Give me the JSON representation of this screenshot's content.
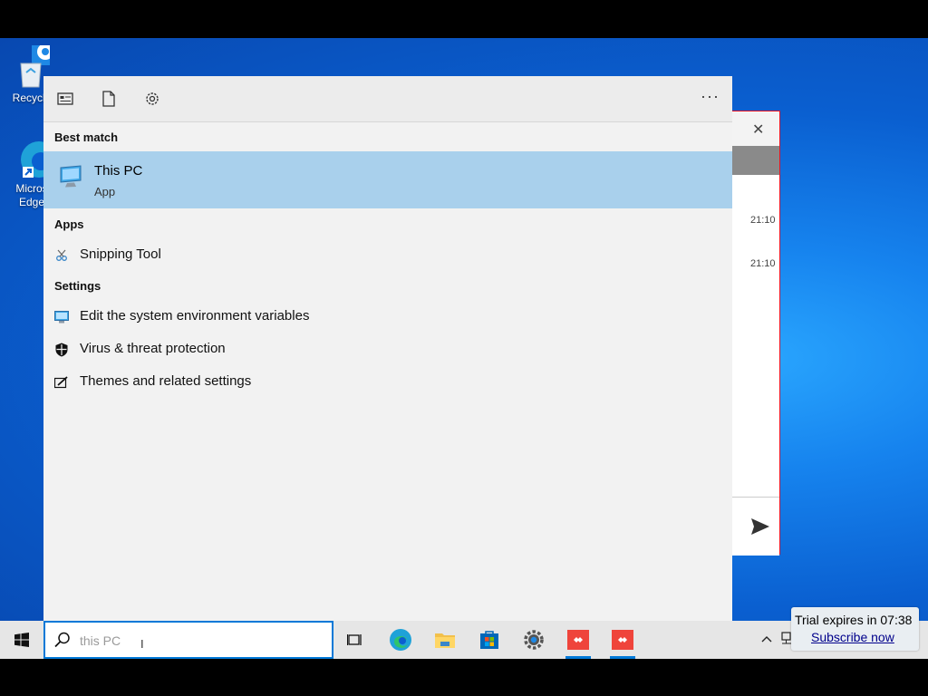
{
  "desktop": {
    "icons": [
      {
        "label": "Recycle"
      },
      {
        "label": "Micros Edge"
      }
    ]
  },
  "start_panel": {
    "best_match_header": "Best match",
    "best_match": {
      "title": "This PC",
      "subtitle": "App"
    },
    "apps_header": "Apps",
    "apps": [
      {
        "label": "Snipping Tool"
      }
    ],
    "settings_header": "Settings",
    "settings": [
      {
        "label": "Edit the system environment variables"
      },
      {
        "label": "Virus & threat protection"
      },
      {
        "label": "Themes and related settings"
      }
    ],
    "more_label": "···"
  },
  "chat_window": {
    "close_label": "✕",
    "times": [
      "21:10",
      "21:10"
    ]
  },
  "taskbar": {
    "search_value": "this PC",
    "icons": [
      "task-view-icon",
      "edge-icon",
      "file-explorer-icon",
      "store-icon",
      "settings-icon",
      "anydesk-icon",
      "anydesk-icon"
    ]
  },
  "trial": {
    "text": "Trial expires in 07:38",
    "link": "Subscribe now"
  },
  "colors": {
    "accent": "#0078d7",
    "selection": "#a9d0ec",
    "anydesk": "#ef443b"
  }
}
